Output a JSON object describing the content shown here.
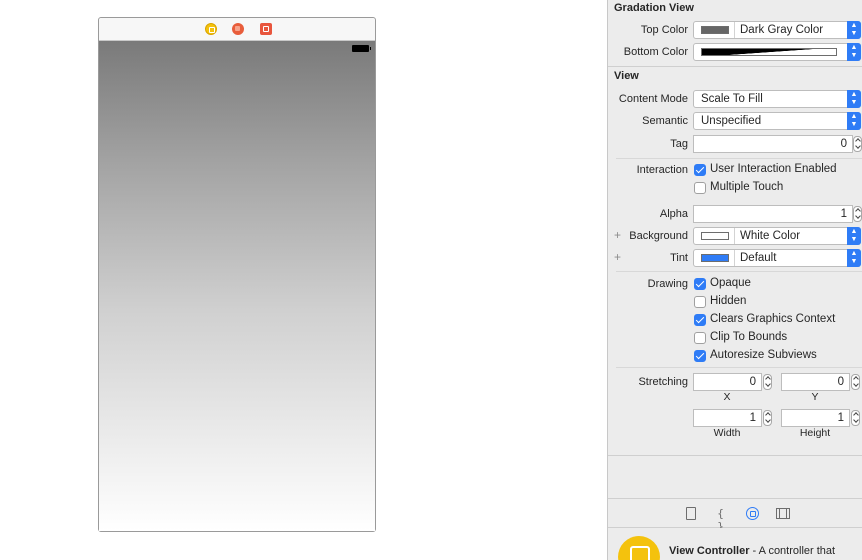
{
  "canvas": {
    "scene_dock_icons": [
      "view-controller-icon",
      "first-responder-icon",
      "exit-icon"
    ],
    "gradient": {
      "top_color": "#7a7a7a",
      "bottom_color": "#ffffff"
    }
  },
  "inspector": {
    "gradation_view": {
      "title": "Gradation View",
      "top_color_label": "Top Color",
      "top_color_value": "Dark Gray Color",
      "top_color_hex": "#666666",
      "bottom_color_label": "Bottom Color",
      "bottom_color_hex": "#000000"
    },
    "view": {
      "title": "View",
      "content_mode_label": "Content Mode",
      "content_mode_value": "Scale To Fill",
      "semantic_label": "Semantic",
      "semantic_value": "Unspecified",
      "tag_label": "Tag",
      "tag_value": "0",
      "interaction_label": "Interaction",
      "user_interaction_label": "User Interaction Enabled",
      "user_interaction_checked": true,
      "multiple_touch_label": "Multiple Touch",
      "multiple_touch_checked": false,
      "alpha_label": "Alpha",
      "alpha_value": "1",
      "plus": "+",
      "background_label": "Background",
      "background_value": "White Color",
      "background_hex": "#ffffff",
      "tint_label": "Tint",
      "tint_value": "Default",
      "tint_hex": "#2f7cf6",
      "drawing_label": "Drawing",
      "opaque_label": "Opaque",
      "opaque_checked": true,
      "hidden_label": "Hidden",
      "hidden_checked": false,
      "clears_label": "Clears Graphics Context",
      "clears_checked": true,
      "clip_label": "Clip To Bounds",
      "clip_checked": false,
      "autoresize_label": "Autoresize Subviews",
      "autoresize_checked": true,
      "stretching_label": "Stretching",
      "stretch_x_value": "0",
      "stretch_y_value": "0",
      "x_caption": "X",
      "y_caption": "Y",
      "stretch_width_value": "1",
      "stretch_height_value": "1",
      "width_caption": "Width",
      "height_caption": "Height"
    },
    "tabs": [
      "file-inspector",
      "quick-help",
      "object-library",
      "media-library"
    ],
    "code_glyph": "{ }",
    "library": {
      "item_title": "View Controller",
      "item_desc": " - A controller that"
    }
  }
}
